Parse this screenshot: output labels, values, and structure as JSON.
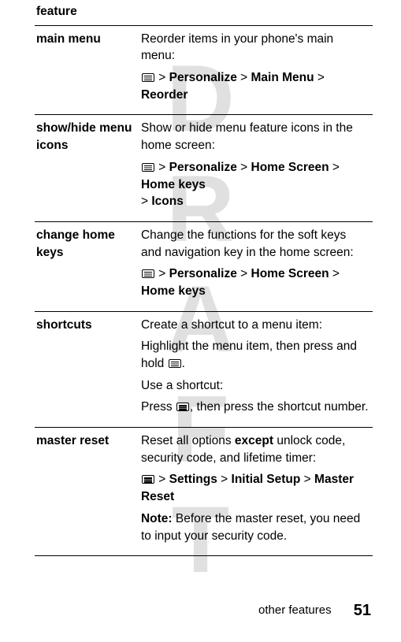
{
  "watermark": "DRAFT",
  "header": "feature",
  "rows": [
    {
      "label": "main menu",
      "desc": "Reorder items in your phone's main menu:",
      "path_parts": {
        "a": "Personalize",
        "b": "Main Menu",
        "c": "Reorder"
      }
    },
    {
      "label": "show/hide menu icons",
      "desc": "Show or hide menu feature icons in the home screen:",
      "path_parts": {
        "a": "Personalize",
        "b": "Home Screen",
        "c": "Home keys",
        "d": "Icons"
      }
    },
    {
      "label": "change home keys",
      "desc": "Change the functions for the soft keys and navigation key in the home screen:",
      "path_parts": {
        "a": "Personalize",
        "b": "Home Screen",
        "c": "Home keys"
      }
    },
    {
      "label": "shortcuts",
      "desc1": "Create a shortcut to a menu item:",
      "desc2a": "Highlight the menu item, then press and hold ",
      "desc2b": ".",
      "desc3": "Use a shortcut:",
      "desc4a": "Press ",
      "desc4b": ", then press the shortcut number."
    },
    {
      "label": "master reset",
      "desc": "Reset all options ",
      "desc_bold": "except",
      "desc_after": " unlock code, security code, and lifetime timer:",
      "path_parts": {
        "a": "Settings",
        "b": "Initial Setup",
        "c": "Master Reset"
      },
      "note_label": "Note: ",
      "note_text": "Before the master reset, you need to input your security code."
    }
  ],
  "gt": ">",
  "footer": {
    "section": "other features",
    "page": "51"
  }
}
